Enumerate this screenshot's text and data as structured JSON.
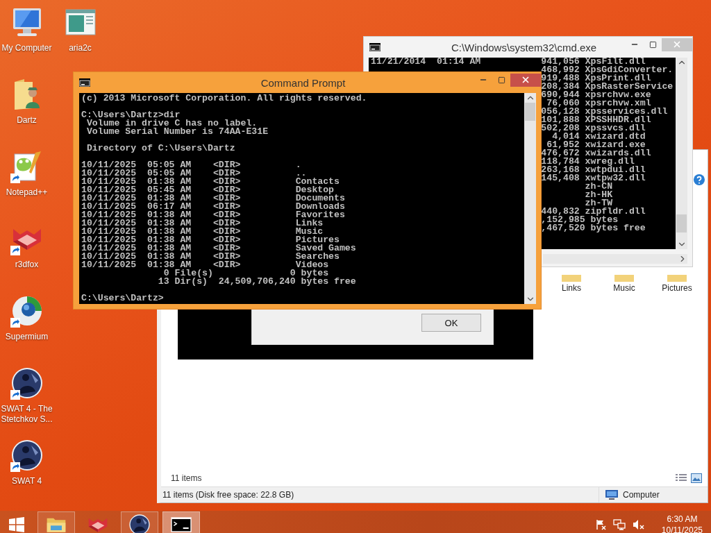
{
  "desktop_icons": [
    {
      "label": "My Computer",
      "kind": "computer",
      "shortcut": false
    },
    {
      "label": "aria2c",
      "kind": "app-window",
      "shortcut": false
    },
    {
      "label": "Dartz",
      "kind": "user-folder",
      "shortcut": false
    },
    {
      "label": "Notepad++",
      "kind": "notepad",
      "shortcut": true
    },
    {
      "label": "r3dfox",
      "kind": "fox",
      "shortcut": true
    },
    {
      "label": "Supermium",
      "kind": "browser",
      "shortcut": true
    },
    {
      "label": "SWAT 4 - The Stetchkov S...",
      "kind": "emblem",
      "shortcut": true
    },
    {
      "label": "SWAT 4",
      "kind": "emblem",
      "shortcut": true
    }
  ],
  "explorer": {
    "items": [
      "Links",
      "Music",
      "Pictures"
    ],
    "item_count": "11 items",
    "status": "11 items (Disk free space: 22.8 GB)",
    "location": "Computer"
  },
  "dialog": {
    "button": "OK"
  },
  "back_console_window": {
    "title": "C:\\Windows\\system32\\cmd.exe",
    "lines_above": [
      "11/21/2014  01:14 AM           941,056 XpsFilt.dll"
    ],
    "lines_beside": [
      "468,992 XpsGdiConverter.",
      "919,488 XpsPrint.dll",
      "208,384 XpsRasterService",
      "690,944 xpsrchvw.exe",
      " 76,060 xpsrchvw.xml",
      "056,128 xpsservices.dll",
      "101,888 XPSSHHDR.dll",
      "502,208 xpssvcs.dll",
      "  4,014 xwizard.dtd",
      " 61,952 xwizard.exe",
      "476,672 xwizards.dll",
      "118,784 xwreg.dll",
      "263,168 xwtpdui.dll",
      "145,408 xwtpw32.dll",
      "        zh-CN",
      "        zh-HK",
      "        zh-TW",
      "440,832 zipfldr.dll",
      ",152,985 bytes",
      ",467,520 bytes free"
    ]
  },
  "command_prompt_window": {
    "title": "Command Prompt",
    "blocks": [
      [
        "(c) 2013 Microsoft Corporation. All rights reserved."
      ],
      [
        "C:\\Users\\Dartz>dir",
        " Volume in drive C has no label.",
        " Volume Serial Number is 74AA-E31E"
      ],
      [
        " Directory of C:\\Users\\Dartz"
      ],
      [
        "10/11/2025  05:05 AM    <DIR>          .",
        "10/11/2025  05:05 AM    <DIR>          ..",
        "10/11/2025  01:38 AM    <DIR>          Contacts",
        "10/11/2025  05:45 AM    <DIR>          Desktop",
        "10/11/2025  01:38 AM    <DIR>          Documents",
        "10/11/2025  06:17 AM    <DIR>          Downloads",
        "10/11/2025  01:38 AM    <DIR>          Favorites",
        "10/11/2025  01:38 AM    <DIR>          Links",
        "10/11/2025  01:38 AM    <DIR>          Music",
        "10/11/2025  01:38 AM    <DIR>          Pictures",
        "10/11/2025  01:38 AM    <DIR>          Saved Games",
        "10/11/2025  01:38 AM    <DIR>          Searches",
        "10/11/2025  01:38 AM    <DIR>          Videos",
        "               0 File(s)              0 bytes",
        "              13 Dir(s)  24,509,706,240 bytes free"
      ],
      [
        "C:\\Users\\Dartz>"
      ]
    ]
  },
  "taskbar": {
    "apps": [
      {
        "kind": "folder",
        "running": true,
        "active": false
      },
      {
        "kind": "fox",
        "running": false,
        "active": false
      },
      {
        "kind": "emblem",
        "running": true,
        "active": false
      },
      {
        "kind": "console",
        "running": true,
        "active": true
      }
    ],
    "clock": {
      "time": "6:30 AM",
      "date": "10/11/2025"
    }
  }
}
